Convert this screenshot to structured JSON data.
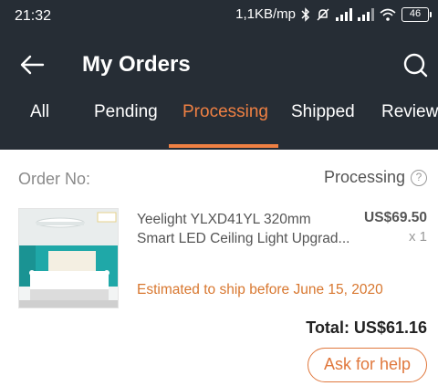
{
  "status_bar": {
    "time": "21:32",
    "network_speed": "1,1KB/mp",
    "battery": "46"
  },
  "header": {
    "title": "My Orders",
    "back_icon": "arrow-left-icon",
    "search_icon": "search-icon"
  },
  "tabs": [
    {
      "label": "All",
      "active": false
    },
    {
      "label": "Pending",
      "active": false
    },
    {
      "label": "Processing",
      "active": true
    },
    {
      "label": "Shipped",
      "active": false
    },
    {
      "label": "Review",
      "active": false
    }
  ],
  "order": {
    "order_no_label": "Order No:",
    "status": "Processing",
    "help_icon_text": "?",
    "product": {
      "name_line1": "Yeelight YLXD41YL 320mm",
      "name_line2": "Smart LED Ceiling Light Upgrad...",
      "price": "US$69.50",
      "quantity": "x 1"
    },
    "ship_note": "Estimated to ship before June 15, 2020",
    "total": "Total: US$61.16",
    "help_button": "Ask for help"
  },
  "colors": {
    "header_bg": "#262d35",
    "accent": "#ef8043",
    "ship_note": "#d8772f"
  }
}
